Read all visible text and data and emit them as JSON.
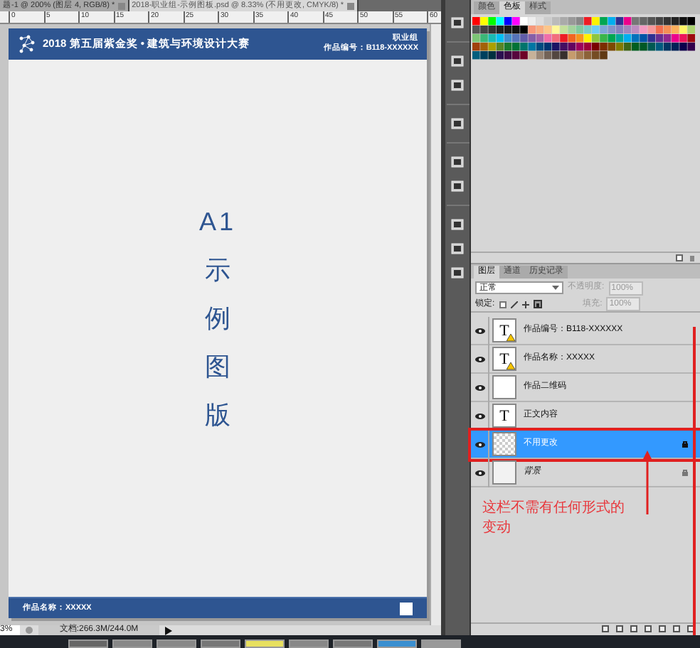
{
  "document_tabs": [
    {
      "label": "题-1 @ 200% (图层 4, RGB/8) *",
      "selected": false
    },
    {
      "label": "2018-职业组-示例图板.psd @ 8.33% (不用更改, CMYK/8) *",
      "selected": true
    }
  ],
  "ruler": [
    "0",
    "5",
    "10",
    "15",
    "20",
    "25",
    "30",
    "35",
    "40",
    "45",
    "50",
    "55",
    "60"
  ],
  "artboard": {
    "header_title": "2018 第五届紫金奖 • 建筑与环境设计大赛",
    "category": "职业组",
    "work_number": "作品编号：B118-XXXXXX",
    "center_lines": [
      "A1",
      "示",
      "例",
      "图",
      "版"
    ],
    "footer_name": "作品名称：XXXXX"
  },
  "status_bar": {
    "zoom": "3%",
    "doc_size": "文档:266.3M/244.0M"
  },
  "swatch_panel": {
    "tabs": [
      {
        "label": "颜色",
        "selected": false
      },
      {
        "label": "色板",
        "selected": true
      },
      {
        "label": "样式",
        "selected": false
      }
    ]
  },
  "layers_panel": {
    "tabs": [
      {
        "label": "图层",
        "selected": true
      },
      {
        "label": "通道",
        "selected": false
      },
      {
        "label": "历史记录",
        "selected": false
      }
    ],
    "blend_mode": "正常",
    "opacity_label": "不透明度:",
    "opacity": "100%",
    "lock_label": "锁定:",
    "fill_label": "填充:",
    "fill": "100%",
    "layers": [
      {
        "name": "作品编号：B118-XXXXXX",
        "kind": "text",
        "glyph": "T",
        "warning": true,
        "selected": false,
        "locked": false
      },
      {
        "name": "作品名称：XXXXX",
        "kind": "text",
        "glyph": "T",
        "warning": true,
        "selected": false,
        "locked": false
      },
      {
        "name": "作品二维码",
        "kind": "plain",
        "warning": false,
        "selected": false,
        "locked": false
      },
      {
        "name": "正文内容",
        "kind": "text",
        "glyph": "T",
        "warning": false,
        "selected": false,
        "locked": false
      },
      {
        "name": "不用更改",
        "kind": "transparent",
        "warning": false,
        "selected": true,
        "locked": true
      },
      {
        "name": "背景",
        "kind": "background",
        "warning": false,
        "selected": false,
        "locked": true
      }
    ],
    "annotation": "这栏不需有任何形式的变动"
  }
}
